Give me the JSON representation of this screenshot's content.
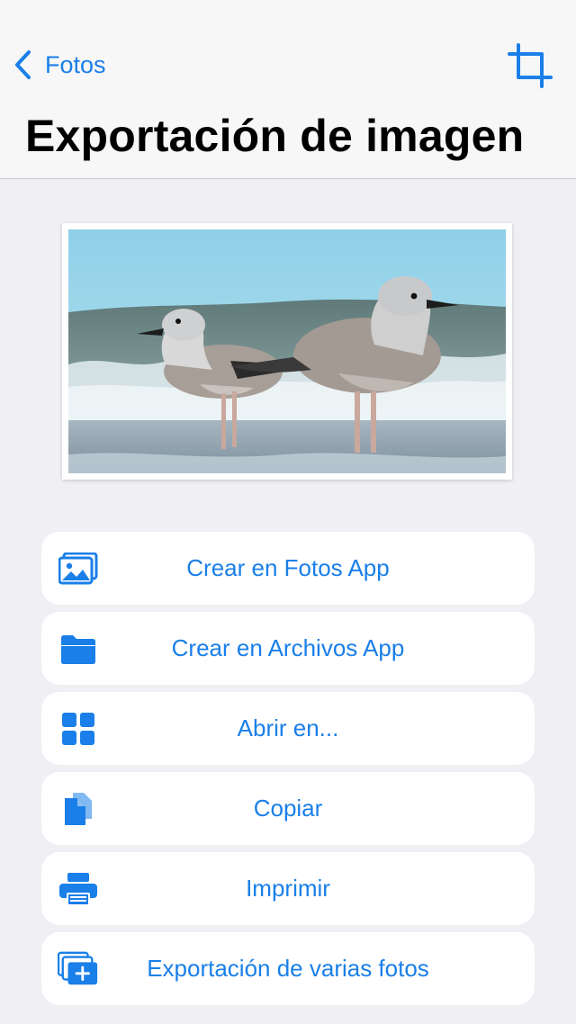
{
  "nav": {
    "back_label": "Fotos",
    "back_icon": "chevron-left-icon",
    "crop_icon": "crop-icon",
    "title": "Exportación de imagen"
  },
  "preview": {
    "subject": "two seagulls on a beach"
  },
  "actions": [
    {
      "label": "Crear en Fotos App",
      "icon": "photo-icon"
    },
    {
      "label": "Crear en Archivos App",
      "icon": "folder-icon"
    },
    {
      "label": "Abrir en...",
      "icon": "grid-icon"
    },
    {
      "label": "Copiar",
      "icon": "copy-icon"
    },
    {
      "label": "Imprimir",
      "icon": "printer-icon"
    },
    {
      "label": "Exportación de varias fotos",
      "icon": "photo-stack-add-icon"
    }
  ],
  "colors": {
    "accent": "#1a7fe8",
    "background": "#efeff4",
    "card": "#ffffff",
    "header": "#f7f7f7"
  }
}
